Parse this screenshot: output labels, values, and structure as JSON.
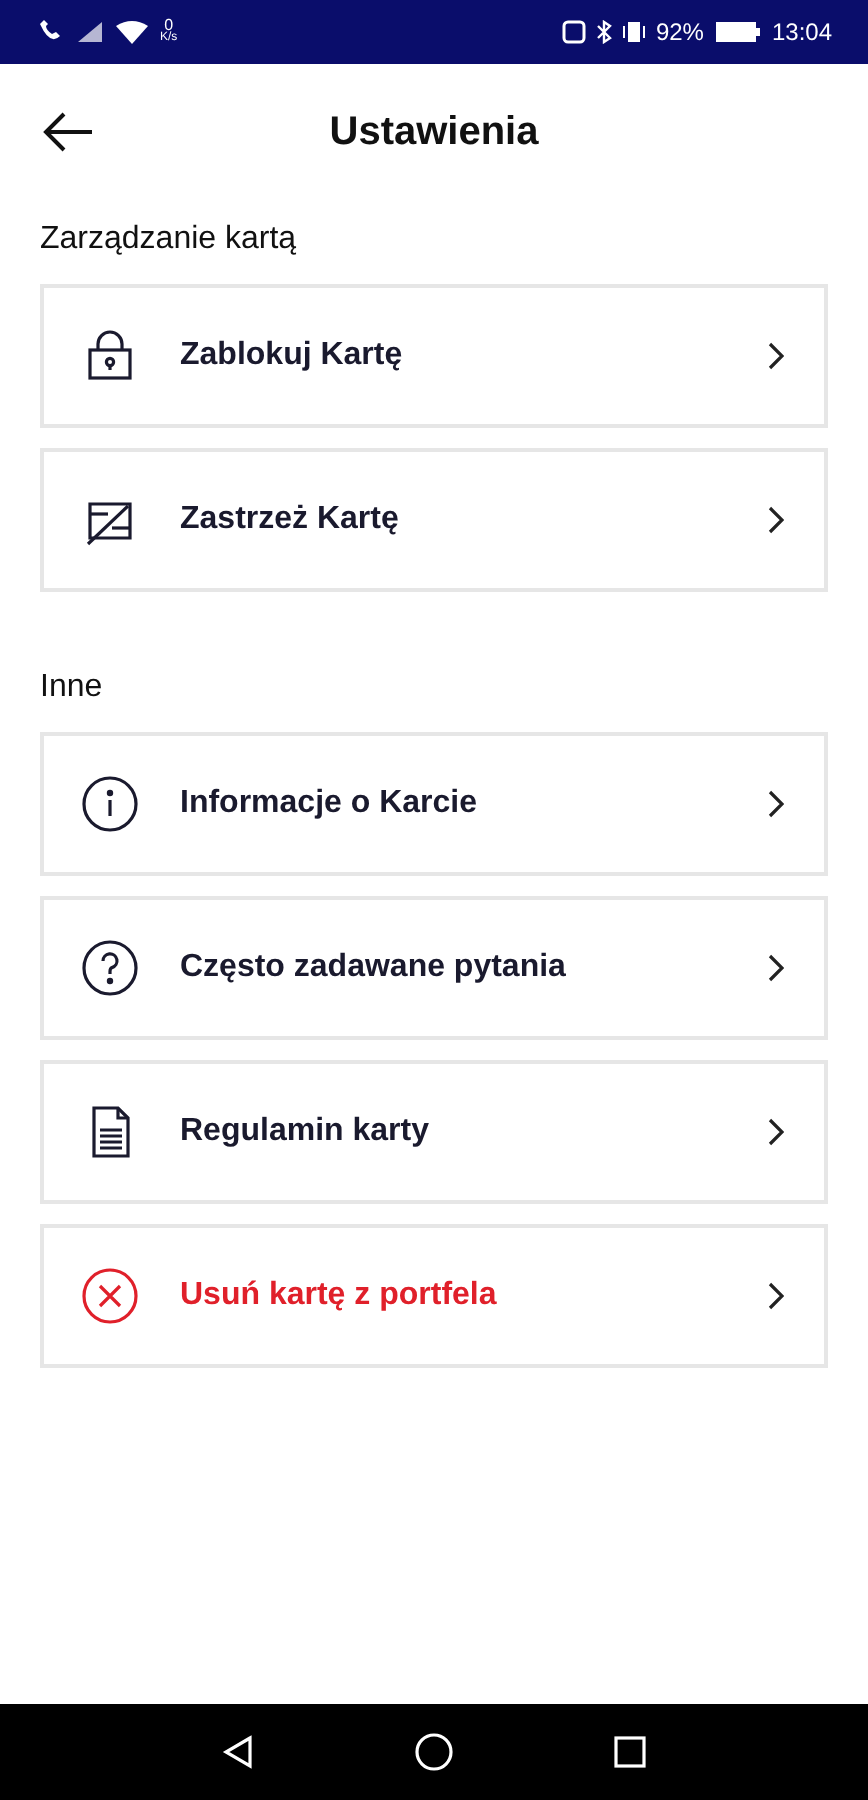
{
  "status_bar": {
    "speed": "0",
    "speed_unit": "K/s",
    "battery": "92%",
    "time": "13:04"
  },
  "header": {
    "title": "Ustawienia"
  },
  "sections": [
    {
      "title": "Zarządzanie kartą",
      "items": [
        {
          "label": "Zablokuj Kartę",
          "kind": "lock",
          "destructive": false
        },
        {
          "label": "Zastrzeż Kartę",
          "kind": "card-cancel",
          "destructive": false
        }
      ]
    },
    {
      "title": "Inne",
      "items": [
        {
          "label": "Informacje o Karcie",
          "kind": "info",
          "destructive": false
        },
        {
          "label": "Często zadawane pytania",
          "kind": "question",
          "destructive": false
        },
        {
          "label": "Regulamin karty",
          "kind": "document",
          "destructive": false
        },
        {
          "label": "Usuń kartę z portfela",
          "kind": "remove",
          "destructive": true
        }
      ]
    }
  ]
}
